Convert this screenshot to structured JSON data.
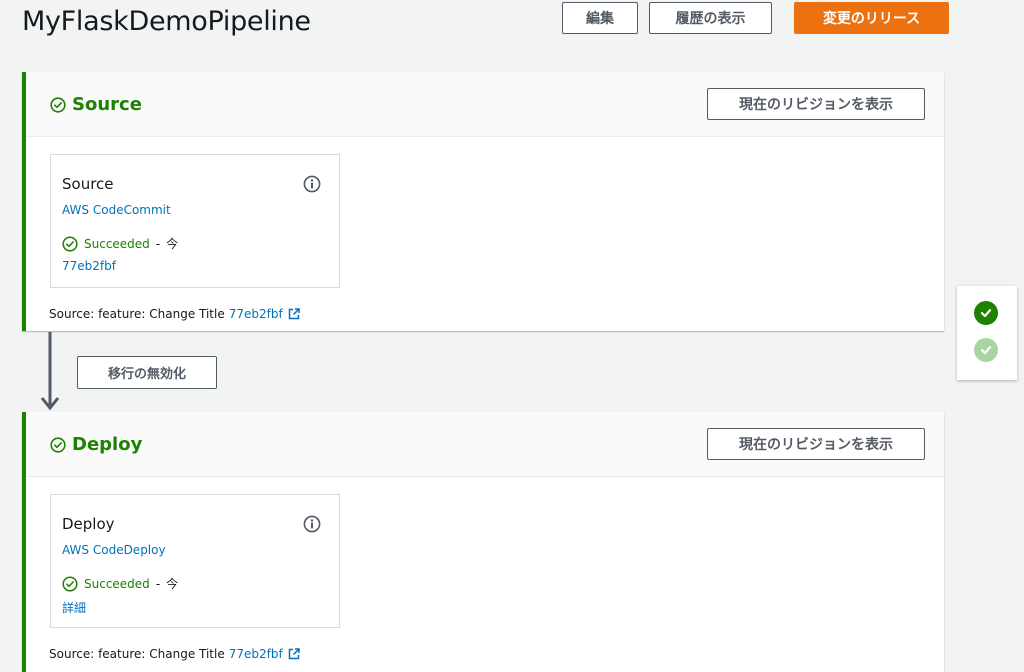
{
  "pipeline": {
    "title": "MyFlaskDemoPipeline"
  },
  "header_buttons": {
    "edit": "編集",
    "history": "履歴の表示",
    "release": "変更のリリース"
  },
  "colors": {
    "success": "#1d8102",
    "link": "#0073bb",
    "primary": "#ec7211"
  },
  "stages": [
    {
      "name": "Source",
      "view_revision": "現在のリビジョンを表示",
      "action": {
        "name": "Source",
        "provider": "AWS CodeCommit",
        "status": "Succeeded",
        "separator": "-",
        "time": "今",
        "detail": "77eb2fbf"
      },
      "footer": {
        "text": "Source: feature: Change Title",
        "revision": "77eb2fbf"
      }
    },
    {
      "name": "Deploy",
      "view_revision": "現在のリビジョンを表示",
      "action": {
        "name": "Deploy",
        "provider": "AWS CodeDeploy",
        "status": "Succeeded",
        "separator": "-",
        "time": "今",
        "detail": "詳細"
      },
      "footer": {
        "text": "Source: feature: Change Title",
        "revision": "77eb2fbf"
      }
    }
  ],
  "transition": {
    "disable_label": "移行の無効化"
  },
  "icons": {
    "stage_status": "check-circle-icon",
    "info": "info-icon",
    "external": "external-link-icon",
    "arrow": "arrow-down-icon",
    "mini_status": [
      "check-filled-icon",
      "check-filled-light-icon"
    ]
  }
}
